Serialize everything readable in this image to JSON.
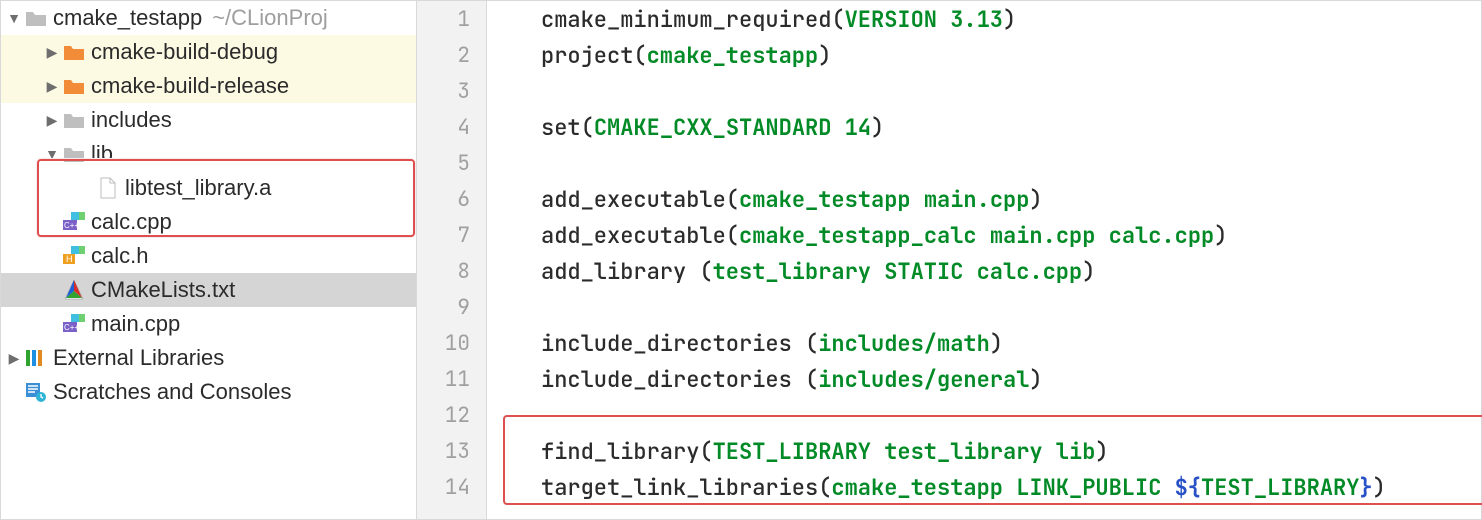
{
  "tree": {
    "root": {
      "name": "cmake_testapp",
      "hint": "~/CLionProj",
      "items": [
        {
          "name": "cmake-build-debug",
          "icon": "folder-orange",
          "arrow": "right",
          "excluded": true,
          "indent": 1
        },
        {
          "name": "cmake-build-release",
          "icon": "folder-orange",
          "arrow": "right",
          "excluded": true,
          "indent": 1
        },
        {
          "name": "includes",
          "icon": "folder-grey",
          "arrow": "right",
          "indent": 1
        },
        {
          "name": "lib",
          "icon": "folder-grey",
          "arrow": "down",
          "indent": 1
        },
        {
          "name": "libtest_library.a",
          "icon": "file-blank",
          "arrow": "none",
          "indent": 2
        },
        {
          "name": "calc.cpp",
          "icon": "cpp-file",
          "arrow": "none",
          "indent": 1
        },
        {
          "name": "calc.h",
          "icon": "h-file",
          "arrow": "none",
          "indent": 1
        },
        {
          "name": "CMakeLists.txt",
          "icon": "cmake-file",
          "arrow": "none",
          "indent": 1,
          "selected": true
        },
        {
          "name": "main.cpp",
          "icon": "cpp-file",
          "arrow": "none",
          "indent": 1
        }
      ]
    },
    "extra": [
      {
        "name": "External Libraries",
        "icon": "ext-libs",
        "arrow": "right"
      },
      {
        "name": "Scratches and Consoles",
        "icon": "scratch",
        "arrow": "none"
      }
    ]
  },
  "editor": {
    "lines": [
      [
        {
          "t": "cmake_minimum_required(",
          "c": "fn"
        },
        {
          "t": "VERSION 3.13",
          "c": "arg"
        },
        {
          "t": ")",
          "c": "fn"
        }
      ],
      [
        {
          "t": "project(",
          "c": "fn"
        },
        {
          "t": "cmake_testapp",
          "c": "arg"
        },
        {
          "t": ")",
          "c": "fn"
        }
      ],
      [],
      [
        {
          "t": "set(",
          "c": "fn"
        },
        {
          "t": "CMAKE_CXX_STANDARD 14",
          "c": "arg"
        },
        {
          "t": ")",
          "c": "fn"
        }
      ],
      [],
      [
        {
          "t": "add_executable(",
          "c": "fn"
        },
        {
          "t": "cmake_testapp main.cpp",
          "c": "arg"
        },
        {
          "t": ")",
          "c": "fn"
        }
      ],
      [
        {
          "t": "add_executable(",
          "c": "fn"
        },
        {
          "t": "cmake_testapp_calc main.cpp calc.cpp",
          "c": "arg"
        },
        {
          "t": ")",
          "c": "fn"
        }
      ],
      [
        {
          "t": "add_library (",
          "c": "fn"
        },
        {
          "t": "test_library STATIC calc.cpp",
          "c": "arg"
        },
        {
          "t": ")",
          "c": "fn"
        }
      ],
      [],
      [
        {
          "t": "include_directories (",
          "c": "fn"
        },
        {
          "t": "includes/math",
          "c": "arg"
        },
        {
          "t": ")",
          "c": "fn"
        }
      ],
      [
        {
          "t": "include_directories (",
          "c": "fn"
        },
        {
          "t": "includes/general",
          "c": "arg"
        },
        {
          "t": ")",
          "c": "fn"
        }
      ],
      [],
      [
        {
          "t": "find_library(",
          "c": "fn"
        },
        {
          "t": "TEST_LIBRARY test_library lib",
          "c": "arg"
        },
        {
          "t": ")",
          "c": "fn"
        }
      ],
      [
        {
          "t": "target_link_libraries(",
          "c": "fn"
        },
        {
          "t": "cmake_testapp LINK_PUBLIC ",
          "c": "arg"
        },
        {
          "t": "${",
          "c": "var"
        },
        {
          "t": "TEST_LIBRARY",
          "c": "arg"
        },
        {
          "t": "}",
          "c": "var"
        },
        {
          "t": ")",
          "c": "fn"
        }
      ]
    ]
  }
}
